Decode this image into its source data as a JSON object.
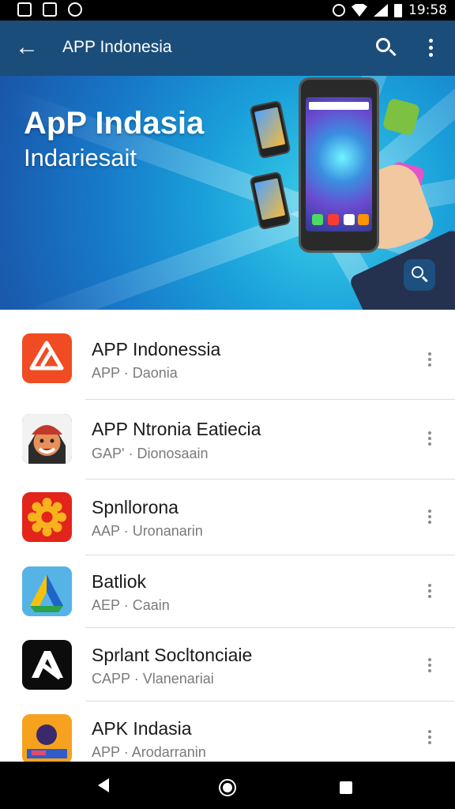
{
  "status_bar": {
    "time": "19:58"
  },
  "app_bar": {
    "title": "APP Indonesia"
  },
  "banner": {
    "title": "ApP Indasia",
    "subtitle": "Indariesait"
  },
  "colors": {
    "app_bar": "#1b4d7a",
    "banner_blue": "#1779c9",
    "accent": "#f04b22"
  },
  "list": [
    {
      "title": "APP Indonessia",
      "subtitle": "APP · Daonia",
      "icon": "orange-share-app-icon"
    },
    {
      "title": "APP Ntronia Eatiecia",
      "subtitle": "GAP' · Dionosaain",
      "icon": "character-face-app-icon"
    },
    {
      "title": "Spnllorona",
      "subtitle": "AAP · Uronanarin",
      "icon": "sun-gear-app-icon"
    },
    {
      "title": "Batliok",
      "subtitle": "AEP · Caain",
      "icon": "triangle-app-icon"
    },
    {
      "title": "Sprlant Socltonciaie",
      "subtitle": "CAPP · Vlanenariai",
      "icon": "black-a-app-icon"
    },
    {
      "title": "APK Indasia",
      "subtitle": "APP · Arodarranin",
      "icon": "cartoon-app-icon"
    }
  ]
}
